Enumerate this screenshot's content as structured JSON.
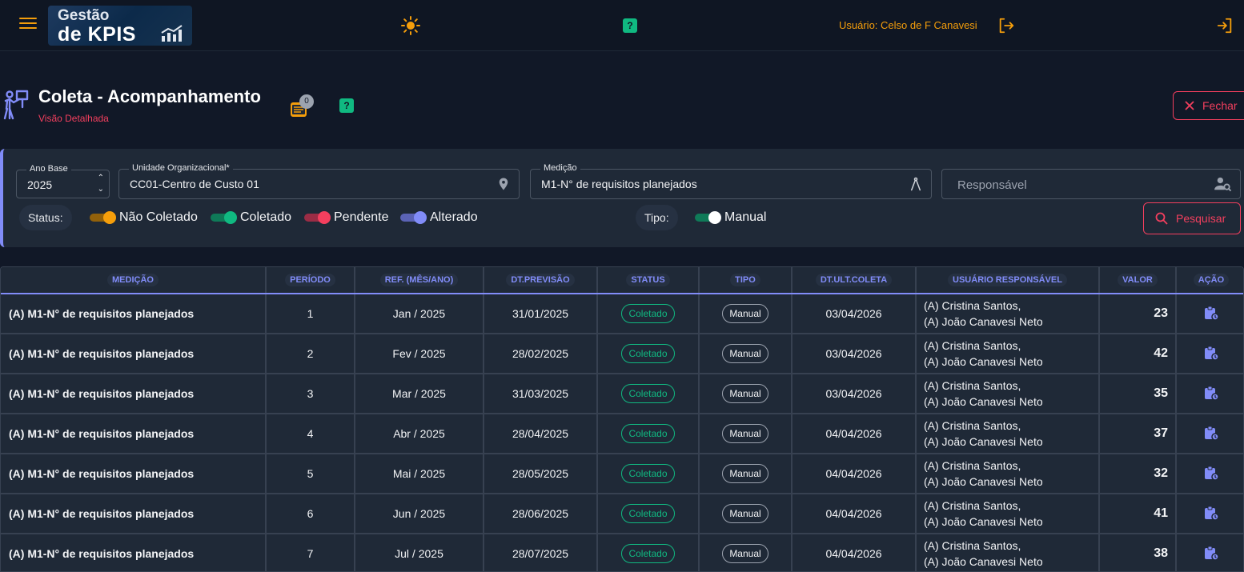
{
  "header": {
    "logo_line1": "Gestão",
    "logo_line2": "de KPIS",
    "user_label": "Usuário: Celso de F Canavesi",
    "help": "?"
  },
  "page": {
    "title": "Coleta - Acompanhamento",
    "subtitle": "Visão Detalhada",
    "notes_count": "0",
    "help": "?",
    "close_label": "Fechar"
  },
  "filters": {
    "ano_base": {
      "label": "Ano Base",
      "value": "2025"
    },
    "unidade": {
      "label": "Unidade Organizacional*",
      "value": "CC01-Centro de Custo 01"
    },
    "medicao": {
      "label": "Medição",
      "value": "M1-N° de requisitos planejados"
    },
    "responsavel": {
      "placeholder": "Responsável"
    },
    "status_label": "Status:",
    "status_options": [
      {
        "label": "Não Coletado",
        "color": "#f59e0b",
        "track": "#92610a"
      },
      {
        "label": "Coletado",
        "color": "#10b981",
        "track": "#0f7a58"
      },
      {
        "label": "Pendente",
        "color": "#f43f5e",
        "track": "#9b2c45"
      },
      {
        "label": "Alterado",
        "color": "#818cf8",
        "track": "#5b63b5"
      }
    ],
    "tipo_label": "Tipo:",
    "tipo_option": {
      "label": "Manual",
      "color": "#ffffff",
      "track": "#0f7a58"
    },
    "search_label": "Pesquisar"
  },
  "table": {
    "headers": [
      "MEDIÇÃO",
      "PERÍODO",
      "REF. (MÊS/ANO)",
      "DT.PREVISÃO",
      "STATUS",
      "TIPO",
      "DT.ULT.COLETA",
      "USUÁRIO RESPONSÁVEL",
      "VALOR",
      "AÇÃO"
    ],
    "rows": [
      {
        "medicao": "(A) M1-N° de requisitos planejados",
        "periodo": "1",
        "ref": "Jan / 2025",
        "previsao": "31/01/2025",
        "status": "Coletado",
        "tipo": "Manual",
        "ult_coleta": "03/04/2026",
        "resp1": "(A) Cristina Santos,",
        "resp2": "(A) João Canavesi Neto",
        "valor": "23"
      },
      {
        "medicao": "(A) M1-N° de requisitos planejados",
        "periodo": "2",
        "ref": "Fev / 2025",
        "previsao": "28/02/2025",
        "status": "Coletado",
        "tipo": "Manual",
        "ult_coleta": "03/04/2026",
        "resp1": "(A) Cristina Santos,",
        "resp2": "(A) João Canavesi Neto",
        "valor": "42"
      },
      {
        "medicao": "(A) M1-N° de requisitos planejados",
        "periodo": "3",
        "ref": "Mar / 2025",
        "previsao": "31/03/2025",
        "status": "Coletado",
        "tipo": "Manual",
        "ult_coleta": "03/04/2026",
        "resp1": "(A) Cristina Santos,",
        "resp2": "(A) João Canavesi Neto",
        "valor": "35"
      },
      {
        "medicao": "(A) M1-N° de requisitos planejados",
        "periodo": "4",
        "ref": "Abr / 2025",
        "previsao": "28/04/2025",
        "status": "Coletado",
        "tipo": "Manual",
        "ult_coleta": "04/04/2026",
        "resp1": "(A) Cristina Santos,",
        "resp2": "(A) João Canavesi Neto",
        "valor": "37"
      },
      {
        "medicao": "(A) M1-N° de requisitos planejados",
        "periodo": "5",
        "ref": "Mai / 2025",
        "previsao": "28/05/2025",
        "status": "Coletado",
        "tipo": "Manual",
        "ult_coleta": "04/04/2026",
        "resp1": "(A) Cristina Santos,",
        "resp2": "(A) João Canavesi Neto",
        "valor": "32"
      },
      {
        "medicao": "(A) M1-N° de requisitos planejados",
        "periodo": "6",
        "ref": "Jun / 2025",
        "previsao": "28/06/2025",
        "status": "Coletado",
        "tipo": "Manual",
        "ult_coleta": "04/04/2026",
        "resp1": "(A) Cristina Santos,",
        "resp2": "(A) João Canavesi Neto",
        "valor": "41"
      },
      {
        "medicao": "(A) M1-N° de requisitos planejados",
        "periodo": "7",
        "ref": "Jul / 2025",
        "previsao": "28/07/2025",
        "status": "Coletado",
        "tipo": "Manual",
        "ult_coleta": "04/04/2026",
        "resp1": "(A) Cristina Santos,",
        "resp2": "(A) João Canavesi Neto",
        "valor": "38"
      }
    ]
  },
  "colors": {
    "accent_orange": "#f59e0b",
    "accent_red": "#f43f5e",
    "accent_indigo": "#818cf8",
    "status_green": "#10b981"
  },
  "icons": [
    "menu-icon",
    "sun-icon",
    "help-icon",
    "logout-icon",
    "exit-icon",
    "presentation-icon",
    "notes-icon",
    "close-icon",
    "location-icon",
    "compass-icon",
    "user-search-icon",
    "search-icon",
    "clipboard-clock-icon"
  ]
}
